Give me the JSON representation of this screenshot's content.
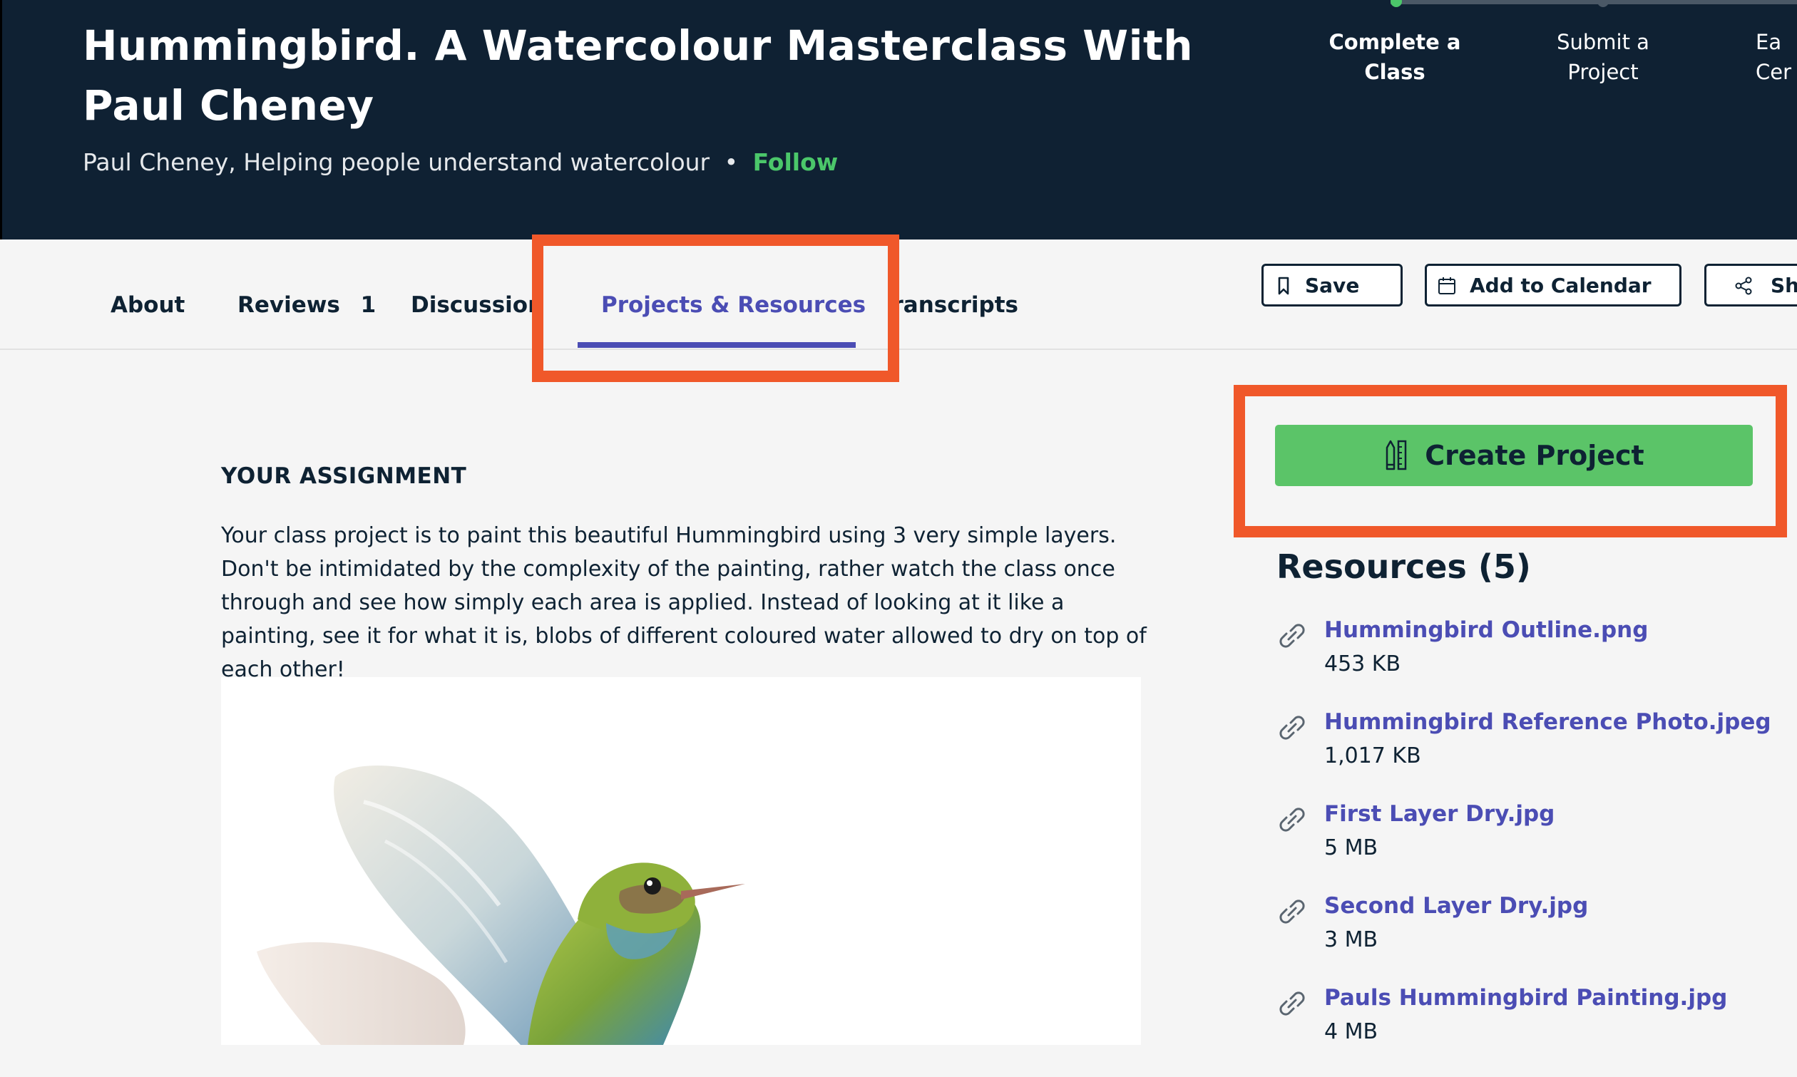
{
  "header": {
    "title": "Hummingbird. A Watercolour Masterclass With Paul Cheney",
    "teacher": "Paul Cheney, Helping people understand watercolour",
    "separator": "•",
    "follow_label": "Follow",
    "steps": [
      {
        "line1": "Complete a",
        "line2": "Class"
      },
      {
        "line1": "Submit a",
        "line2": "Project"
      },
      {
        "line1": "Ea",
        "line2": "Cer"
      }
    ]
  },
  "tabs": [
    {
      "label": "About"
    },
    {
      "label": "Reviews"
    },
    {
      "label": "Discussions"
    },
    {
      "label": "Projects & Resources"
    },
    {
      "label": "Transcripts"
    }
  ],
  "reviews_count": "1",
  "actions": {
    "save_label": "Save",
    "calendar_label": "Add to Calendar",
    "share_label": "Sha"
  },
  "assignment": {
    "heading": "YOUR ASSIGNMENT",
    "text": "Your class project is to paint this beautiful Hummingbird using 3 very simple layers.  Don't be intimidated by the complexity of the painting, rather watch the class once through and see how simply each area is applied.  Instead of looking at it like a painting, see it for what it is, blobs of different coloured water allowed to dry on top of each other!"
  },
  "create_project_label": "Create Project",
  "resources": {
    "title": "Resources (5)",
    "items": [
      {
        "name": "Hummingbird Outline.png",
        "size": "453 KB"
      },
      {
        "name": "Hummingbird Reference Photo.jpeg",
        "size": "1,017 KB"
      },
      {
        "name": "First Layer Dry.jpg",
        "size": "5 MB"
      },
      {
        "name": "Second Layer Dry.jpg",
        "size": "3 MB"
      },
      {
        "name": "Pauls Hummingbird Painting.jpg",
        "size": "4 MB"
      }
    ]
  },
  "colors": {
    "header_bg": "#0f2133",
    "accent_green": "#5bc468",
    "link_purple": "#4b4db4",
    "highlight_orange": "#f0582a"
  }
}
